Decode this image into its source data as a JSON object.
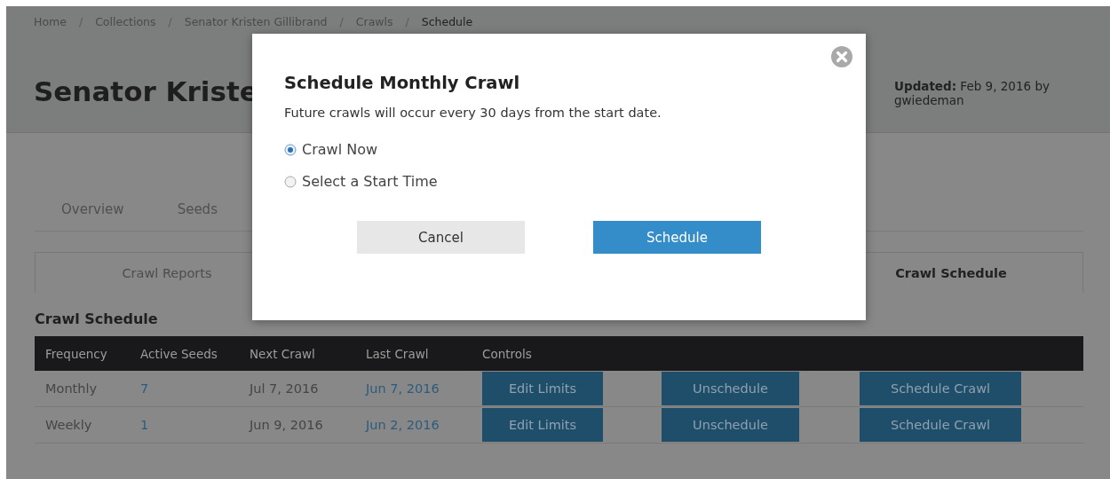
{
  "breadcrumb": [
    {
      "label": "Home",
      "current": false
    },
    {
      "label": "Collections",
      "current": false
    },
    {
      "label": "Senator Kristen Gillibrand",
      "current": false
    },
    {
      "label": "Crawls",
      "current": false
    },
    {
      "label": "Schedule",
      "current": true
    }
  ],
  "breadcrumb_separator": "/",
  "page_title": "Senator Kriste",
  "updated": {
    "label": "Updated:",
    "text": "Feb 9, 2016 by gwiedeman"
  },
  "tabs": [
    {
      "label": "Overview"
    },
    {
      "label": "Seeds"
    }
  ],
  "subtabs": [
    {
      "label": "Crawl Reports",
      "selected": false
    },
    {
      "label": "Crawl Schedule",
      "selected": true
    }
  ],
  "section_title": "Crawl Schedule",
  "table": {
    "columns": [
      "Frequency",
      "Active Seeds",
      "Next Crawl",
      "Last Crawl",
      "Controls"
    ],
    "rows": [
      {
        "frequency": "Monthly",
        "active_seeds": "7",
        "next_crawl": "Jul 7, 2016",
        "last_crawl": "Jun 7, 2016",
        "controls": [
          "Edit Limits",
          "Unschedule",
          "Schedule Crawl"
        ]
      },
      {
        "frequency": "Weekly",
        "active_seeds": "1",
        "next_crawl": "Jun 9, 2016",
        "last_crawl": "Jun 2, 2016",
        "controls": [
          "Edit Limits",
          "Unschedule",
          "Schedule Crawl"
        ]
      }
    ]
  },
  "dialog": {
    "title": "Schedule Monthly Crawl",
    "text": "Future crawls will occur every 30 days from the start date.",
    "options": [
      {
        "label": "Crawl Now",
        "selected": true
      },
      {
        "label": "Select a Start Time",
        "selected": false
      }
    ],
    "buttons": [
      {
        "label": "Cancel",
        "kind": "secondary"
      },
      {
        "label": "Schedule",
        "kind": "primary"
      }
    ]
  }
}
